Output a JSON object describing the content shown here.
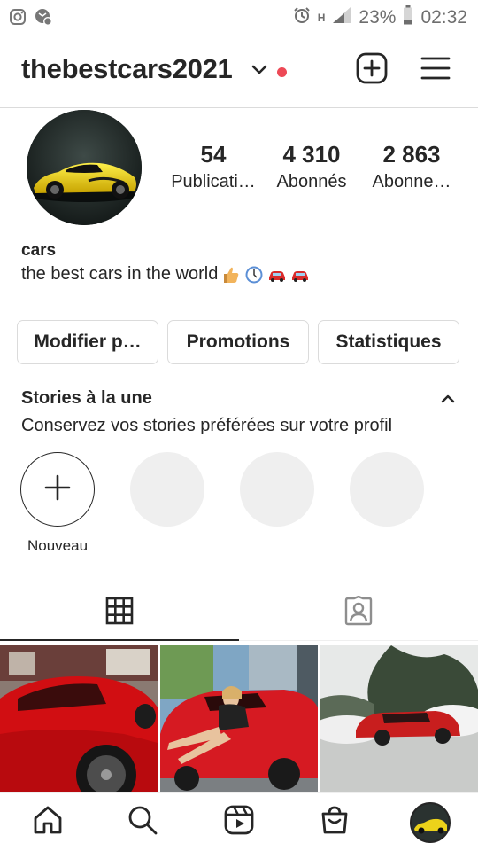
{
  "status_bar": {
    "left_icons": [
      "instagram-icon",
      "notification-icon"
    ],
    "right_icons": [
      "alarm-icon",
      "network-h-icon",
      "signal-icon",
      "battery-icon"
    ],
    "network_label": "H",
    "battery_percent": "23%",
    "time": "02:32"
  },
  "header": {
    "username": "thebestcars2021",
    "icons": [
      "chevron-down-icon",
      "new-post-icon",
      "menu-icon"
    ],
    "notification_dot_color": "#ed4956"
  },
  "profile": {
    "avatar_icon": "yellow-supercar-avatar",
    "stats": [
      {
        "number": "54",
        "label": "Publicati…"
      },
      {
        "number": "4 310",
        "label": "Abonnés"
      },
      {
        "number": "2 863",
        "label": "Abonne…"
      }
    ],
    "name": "cars",
    "bio": "the best cars in the world",
    "bio_emojis": [
      "thumbs-up-icon",
      "clock-icon",
      "red-car-icon",
      "red-car-icon"
    ]
  },
  "actions": {
    "edit_label": "Modifier p…",
    "promotions_label": "Promotions",
    "insights_label": "Statistiques"
  },
  "highlights": {
    "title": "Stories à la une",
    "subtitle": "Conservez vos stories préférées sur votre profil",
    "new_label": "Nouveau"
  },
  "tabs": {
    "icons": [
      "grid-icon",
      "tagged-icon"
    ],
    "active": "grid"
  },
  "posts": [
    {
      "icon": "red-ferrari-photo"
    },
    {
      "icon": "woman-on-red-ferrari-photo"
    },
    {
      "icon": "red-muscle-car-drifting-photo"
    }
  ],
  "bottom_nav": {
    "icons": [
      "home-icon",
      "search-icon",
      "reels-icon",
      "shop-icon",
      "profile-avatar"
    ]
  },
  "colors": {
    "text": "#262626",
    "border": "#dbdbdb",
    "accent_red": "#ed4956",
    "placeholder": "#efefef"
  }
}
